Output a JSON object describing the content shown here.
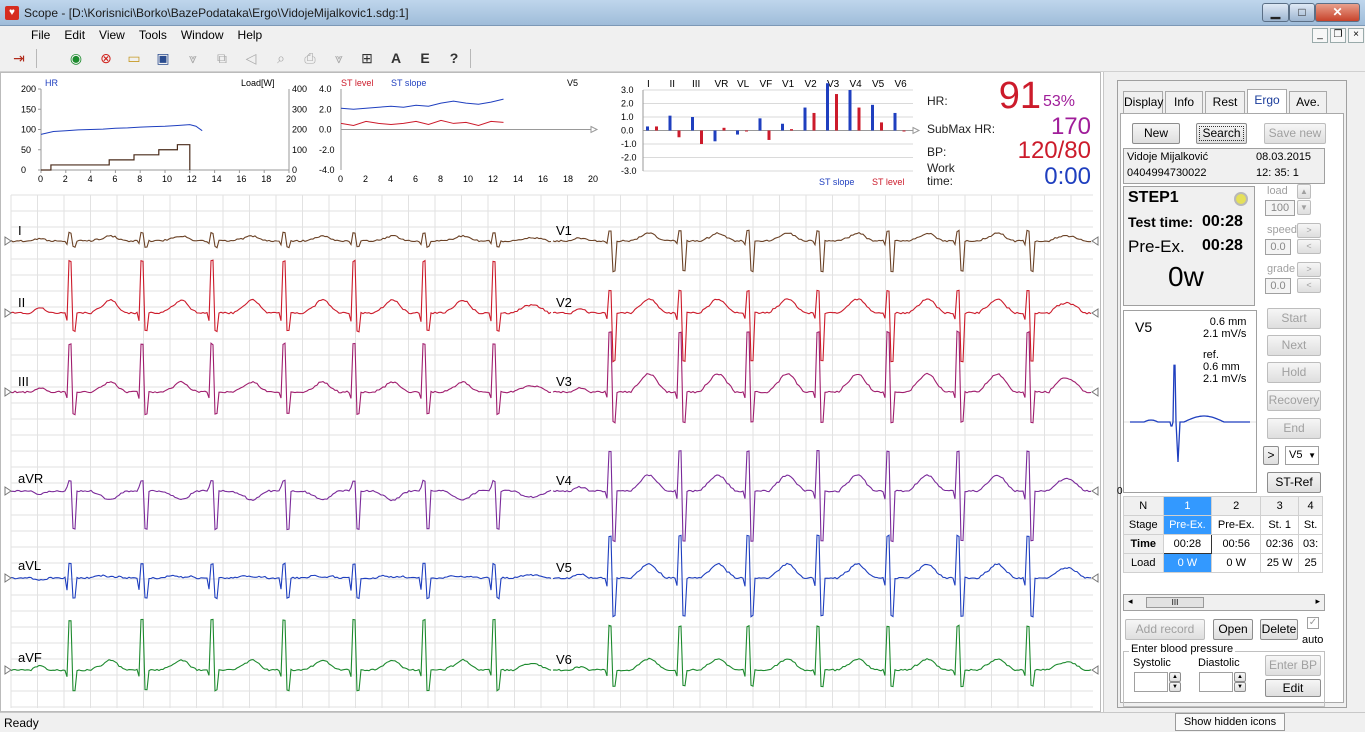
{
  "window": {
    "title": "Scope - [D:\\Korisnici\\Borko\\BazePodataka\\Ergo\\VidojeMijalkovic1.sdg:1]",
    "app_icon": "ecg-heart-icon"
  },
  "menu": [
    "File",
    "Edit",
    "View",
    "Tools",
    "Window",
    "Help"
  ],
  "toolbar": {
    "icons": [
      "exit-icon",
      "record-icon",
      "stop-icon",
      "open-folder-icon",
      "save-icon",
      "filter-icon",
      "copy-icon",
      "ruler-icon",
      "print-preview-icon",
      "print-icon",
      "export-icon",
      "grid-icon",
      "text-icon",
      "letter-e-icon",
      "help-icon"
    ]
  },
  "trend_chart_hr": {
    "title": "HR",
    "right_label": "Load[W]",
    "y_left_ticks": [
      "200",
      "150",
      "100",
      "50",
      "0"
    ],
    "y_right_ticks": [
      "400",
      "300",
      "200",
      "100",
      "0"
    ],
    "x_ticks": [
      "0",
      "2",
      "4",
      "6",
      "8",
      "10",
      "12",
      "14",
      "16",
      "18",
      "20"
    ]
  },
  "trend_chart_st": {
    "title_level": "ST level",
    "title_slope": "ST slope",
    "lead": "V5",
    "y_ticks": [
      "4.0",
      "2.0",
      "0.0",
      "-2.0",
      "-4.0"
    ],
    "x_ticks": [
      "0",
      "2",
      "4",
      "6",
      "8",
      "10",
      "12",
      "14",
      "16",
      "18",
      "20"
    ]
  },
  "st_bars": {
    "leads": [
      "I",
      "II",
      "III",
      "VR",
      "VL",
      "VF",
      "V1",
      "V2",
      "V3",
      "V4",
      "V5",
      "V6"
    ],
    "y_ticks": [
      "3.0",
      "2.0",
      "1.0",
      "0.0",
      "-1.0",
      "-2.0",
      "-3.0"
    ],
    "legend_slope": "ST slope",
    "legend_level": "ST level"
  },
  "chart_data": [
    {
      "type": "line",
      "title": "HR",
      "ylabel_right": "Load[W]",
      "x_range": [
        0,
        20
      ],
      "y_range": [
        0,
        200
      ],
      "y2_range": [
        0,
        400
      ],
      "series": [
        {
          "name": "HR",
          "x": [
            0,
            1,
            2,
            3,
            4,
            5,
            6,
            7,
            8,
            9,
            10,
            11,
            12,
            12.5,
            13
          ],
          "values": [
            88,
            95,
            97,
            99,
            100,
            101,
            103,
            104,
            106,
            107,
            108,
            110,
            112,
            108,
            97
          ]
        },
        {
          "name": "Load[W]",
          "x": [
            0,
            0.8,
            0.8,
            5.5,
            5.5,
            7.5,
            7.5,
            9.5,
            9.5,
            11,
            11,
            12,
            12
          ],
          "values": [
            0,
            0,
            25,
            25,
            50,
            50,
            75,
            75,
            100,
            100,
            125,
            125,
            0
          ]
        }
      ]
    },
    {
      "type": "line",
      "x_range": [
        0,
        20
      ],
      "y_range": [
        -4,
        4
      ],
      "series": [
        {
          "name": "ST slope",
          "x": [
            0,
            1,
            2,
            3,
            4,
            5,
            6,
            7,
            8,
            9,
            10,
            11,
            12,
            13
          ],
          "values": [
            2.1,
            2.0,
            2.1,
            2.2,
            2.3,
            2.2,
            2.4,
            2.3,
            2.6,
            2.8,
            2.6,
            2.5,
            2.7,
            3.0
          ]
        },
        {
          "name": "ST level",
          "x": [
            0,
            1,
            2,
            3,
            4,
            5,
            6,
            7,
            8,
            9,
            10,
            11,
            12,
            13
          ],
          "values": [
            0.6,
            0.4,
            0.8,
            0.6,
            0.5,
            0.6,
            0.8,
            0.5,
            0.9,
            0.6,
            0.7,
            0.4,
            0.8,
            0.7
          ]
        }
      ]
    },
    {
      "type": "bar",
      "categories": [
        "I",
        "II",
        "III",
        "VR",
        "VL",
        "VF",
        "V1",
        "V2",
        "V3",
        "V4",
        "V5",
        "V6"
      ],
      "y_range": [
        -3,
        3
      ],
      "series": [
        {
          "name": "ST slope",
          "values": [
            0.3,
            1.1,
            1.0,
            -0.8,
            -0.3,
            0.9,
            0.5,
            1.7,
            3.5,
            3.0,
            1.9,
            1.3
          ]
        },
        {
          "name": "ST level",
          "values": [
            0.3,
            -0.5,
            -1.0,
            0.2,
            0.0,
            -0.7,
            0.1,
            1.3,
            2.7,
            1.7,
            0.6,
            0.0
          ]
        }
      ]
    }
  ],
  "readouts": {
    "hr_label": "HR:",
    "hr_value": "91",
    "hr_pct": "53%",
    "submax_label": "SubMax HR:",
    "submax_value": "170",
    "bp_label": "BP:",
    "bp_value": "120/80",
    "work_label1": "Work",
    "work_label2": "time:",
    "work_value": "0:00"
  },
  "ecg": {
    "left_leads": [
      "I",
      "II",
      "III",
      "aVR",
      "aVL",
      "aVF"
    ],
    "right_leads": [
      "V1",
      "V2",
      "V3",
      "V4",
      "V5",
      "V6"
    ],
    "colors": {
      "I": "#6b4226",
      "II": "#cc1b2b",
      "III": "#a01e6e",
      "aVR": "#7a2a9a",
      "aVL": "#1f3fbf",
      "aVF": "#1d8a2e",
      "V1": "#6b4226",
      "V2": "#cc1b2b",
      "V3": "#a01e6e",
      "V4": "#7a2a9a",
      "V5": "#1f3fbf",
      "V6": "#1d8a2e"
    }
  },
  "panel": {
    "tabs": [
      "Display",
      "Info",
      "Rest",
      "Ergo",
      "Ave."
    ],
    "active_tab": "Ergo",
    "new_label": "New",
    "search_label": "Search",
    "save_new_label": "Save new",
    "patient_name": "Vidoje Mijalković",
    "patient_date": "08.03.2015",
    "patient_id": "0404994730022",
    "patient_time": "12: 35: 1",
    "step": "STEP1",
    "test_time_label": "Test time:",
    "test_time": "00:28",
    "phase_label": "Pre-Ex.",
    "phase_time": "00:28",
    "load_display": "0w",
    "load_label": "load",
    "load_value": "100",
    "speed_label": "speed",
    "speed_value": "0.0",
    "grade_label": "grade",
    "grade_value": "0.0",
    "start": "Start",
    "next": "Next",
    "hold": "Hold",
    "recovery": "Recovery",
    "end": "End",
    "lead_select": "V5",
    "st_ref": "ST-Ref",
    "arrow_right": ">",
    "v5_label": "V5",
    "v5_line1": "0.6 mm",
    "v5_line2": "2.1 mV/s",
    "ref_label": "ref.",
    "ref_line1": "0.6 mm",
    "ref_line2": "2.1 mV/s",
    "zero_label": "0",
    "table_header": [
      "N",
      "1",
      "2",
      "3",
      "4"
    ],
    "table_rows": [
      [
        "Stage",
        "Pre-Ex.",
        "Pre-Ex.",
        "St. 1",
        "St."
      ],
      [
        "Time",
        "00:28",
        "00:56",
        "02:36",
        "03:"
      ],
      [
        "Load",
        "0 W",
        "0 W",
        "25 W",
        "25"
      ]
    ],
    "scroll_thumb": "III",
    "add_record": "Add record",
    "open": "Open",
    "delete": "Delete",
    "auto": "auto",
    "bp_group": "Enter blood pressure",
    "systolic": "Systolic",
    "diastolic": "Diastolic",
    "enter_bp": "Enter BP",
    "edit": "Edit"
  },
  "status": {
    "text": "Ready",
    "hidden_icons": "Show hidden icons"
  }
}
